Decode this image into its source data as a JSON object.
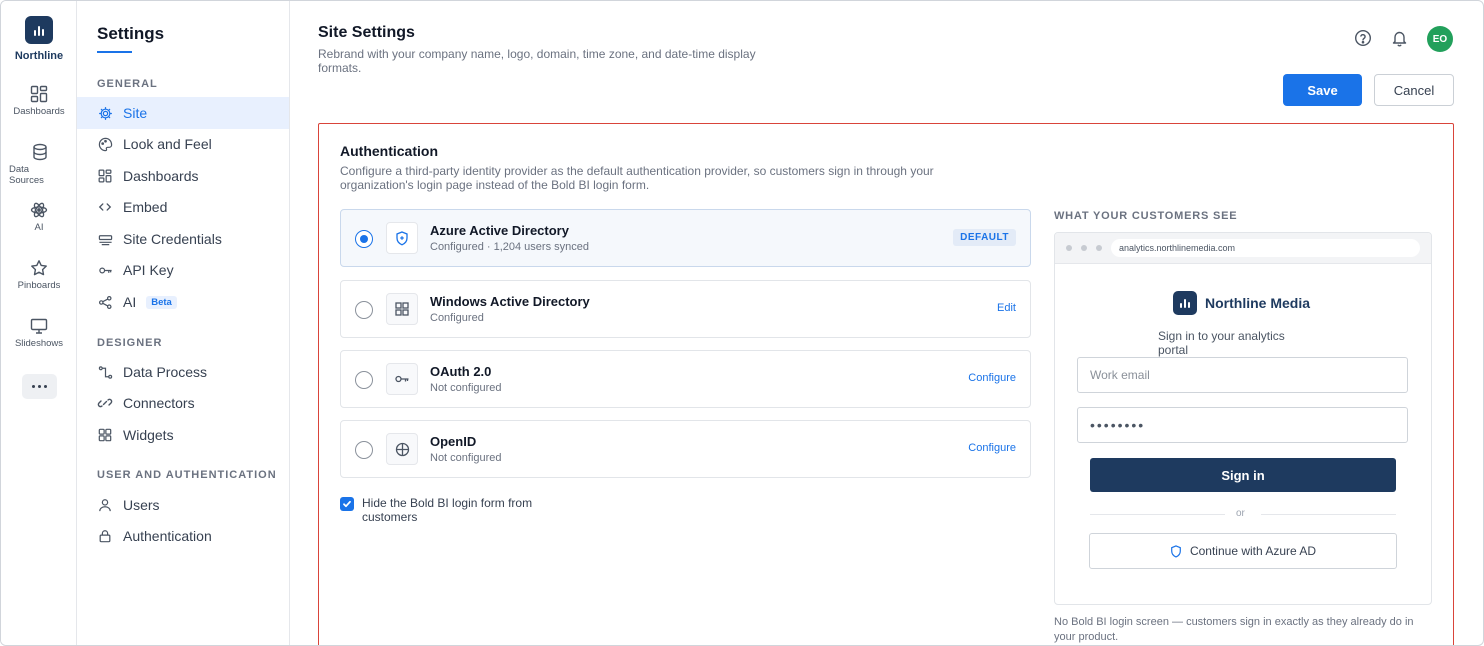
{
  "rail": {
    "brand": "Northline",
    "items": [
      {
        "label": "Dashboards",
        "icon": "dashboards-icon"
      },
      {
        "label": "Data Sources",
        "icon": "database-icon"
      },
      {
        "label": "AI",
        "icon": "atom-icon"
      },
      {
        "label": "Pinboards",
        "icon": "star-icon"
      },
      {
        "label": "Slideshows",
        "icon": "monitor-icon"
      }
    ]
  },
  "nav": {
    "title": "Settings",
    "sections": {
      "general": "GENERAL",
      "designer": "DESIGNER",
      "user_auth": "USER AND AUTHENTICATION"
    },
    "items": {
      "site": "Site",
      "look_and_feel": "Look and Feel",
      "dashboards": "Dashboards",
      "embed": "Embed",
      "site_credentials": "Site Credentials",
      "api_key": "API Key",
      "ai": "AI",
      "ai_badge": "Beta",
      "data_process": "Data Process",
      "connectors": "Connectors",
      "widgets": "Widgets",
      "users": "Users",
      "authentication": "Authentication"
    }
  },
  "header": {
    "title": "Site Settings",
    "subtitle": "Rebrand with your company name, logo, domain, time zone, and date-time display formats.",
    "avatar_initials": "EO",
    "save_label": "Save",
    "cancel_label": "Cancel"
  },
  "auth": {
    "title": "Authentication",
    "description": "Configure a third-party identity provider as the default authentication provider, so customers sign in through your organization's login page instead of the Bold BI login form.",
    "providers": [
      {
        "name": "Azure Active Directory",
        "status": "Configured · 1,204 users synced",
        "badge": "DEFAULT"
      },
      {
        "name": "Windows Active Directory",
        "status": "Configured",
        "action": "Edit"
      },
      {
        "name": "OAuth 2.0",
        "status": "Not configured",
        "action": "Configure"
      },
      {
        "name": "OpenID",
        "status": "Not configured",
        "action": "Configure"
      }
    ],
    "hide_login_label": "Hide the Bold BI login form from customers",
    "hide_login_checked": true
  },
  "preview": {
    "label": "WHAT YOUR CUSTOMERS SEE",
    "url": "analytics.northlinemedia.com",
    "brand": "Northline Media",
    "subtitle": "Sign in to your analytics portal",
    "email_placeholder": "Work email",
    "password_mask": "••••••••",
    "signin_label": "Sign in",
    "or_label": "or",
    "azure_button_label": "Continue with Azure AD",
    "note": "No Bold BI login screen — customers sign in exactly as they already do in your product."
  },
  "colors": {
    "accent": "#1a73e8",
    "brand": "#1e3a5f",
    "avatar": "#22a05b",
    "panel_border": "#d9443a"
  }
}
